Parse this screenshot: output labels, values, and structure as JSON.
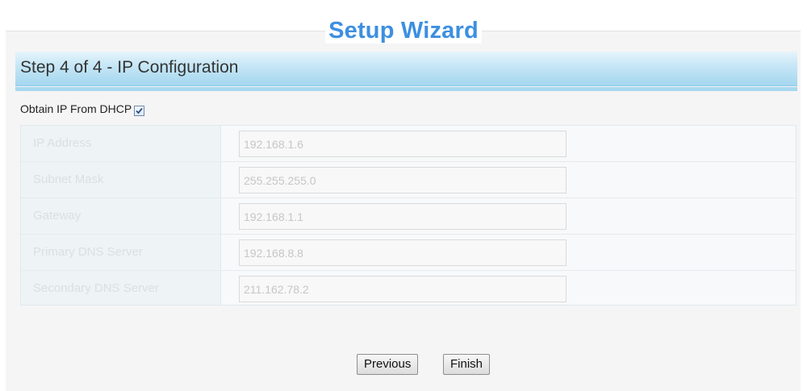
{
  "wizard": {
    "title": "Setup Wizard",
    "step_title": "Step 4 of 4 - IP Configuration"
  },
  "dhcp": {
    "label": "Obtain IP From DHCP",
    "checked": true
  },
  "fields": [
    {
      "label": "IP Address",
      "value": "192.168.1.6"
    },
    {
      "label": "Subnet Mask",
      "value": "255.255.255.0"
    },
    {
      "label": "Gateway",
      "value": "192.168.1.1"
    },
    {
      "label": "Primary DNS Server",
      "value": "192.168.8.8"
    },
    {
      "label": "Secondary DNS Server",
      "value": "211.162.78.2"
    }
  ],
  "buttons": {
    "previous": "Previous",
    "finish": "Finish"
  },
  "colors": {
    "title": "#3d8fe0",
    "step_bar": "#a4d6ef"
  }
}
